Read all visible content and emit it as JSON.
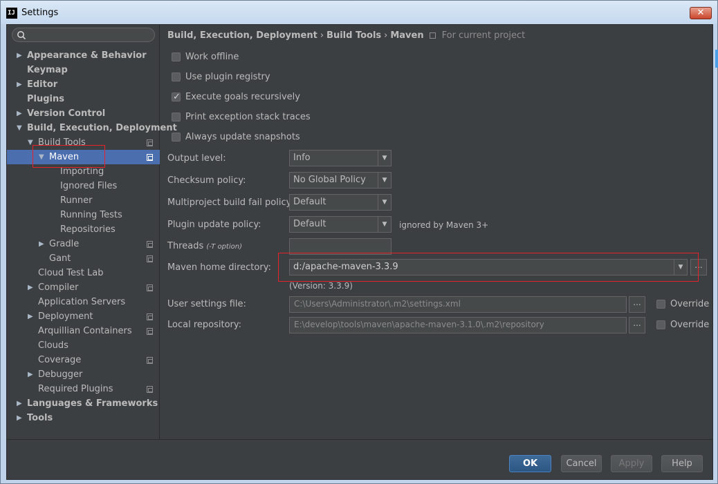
{
  "window": {
    "title": "Settings",
    "app_icon": "IJ",
    "close_label": "✕"
  },
  "search": {
    "placeholder": ""
  },
  "tree": [
    {
      "label": "Appearance & Behavior",
      "bold": true,
      "arrow": "▶",
      "level": 0
    },
    {
      "label": "Keymap",
      "bold": true,
      "arrow": "",
      "level": 0
    },
    {
      "label": "Editor",
      "bold": true,
      "arrow": "▶",
      "level": 0
    },
    {
      "label": "Plugins",
      "bold": true,
      "arrow": "",
      "level": 0
    },
    {
      "label": "Version Control",
      "bold": true,
      "arrow": "▶",
      "level": 0
    },
    {
      "label": "Build, Execution, Deployment",
      "bold": true,
      "arrow": "▼",
      "level": 0
    },
    {
      "label": "Build Tools",
      "bold": false,
      "arrow": "▼",
      "level": 1,
      "project": true
    },
    {
      "label": "Maven",
      "bold": false,
      "arrow": "▼",
      "level": 2,
      "project": true,
      "selected": true
    },
    {
      "label": "Importing",
      "bold": false,
      "arrow": "",
      "level": 3
    },
    {
      "label": "Ignored Files",
      "bold": false,
      "arrow": "",
      "level": 3
    },
    {
      "label": "Runner",
      "bold": false,
      "arrow": "",
      "level": 3
    },
    {
      "label": "Running Tests",
      "bold": false,
      "arrow": "",
      "level": 3
    },
    {
      "label": "Repositories",
      "bold": false,
      "arrow": "",
      "level": 3
    },
    {
      "label": "Gradle",
      "bold": false,
      "arrow": "▶",
      "level": 2,
      "project": true
    },
    {
      "label": "Gant",
      "bold": false,
      "arrow": "",
      "level": 2,
      "project": true
    },
    {
      "label": "Cloud Test Lab",
      "bold": false,
      "arrow": "",
      "level": 1
    },
    {
      "label": "Compiler",
      "bold": false,
      "arrow": "▶",
      "level": 1,
      "project": true
    },
    {
      "label": "Application Servers",
      "bold": false,
      "arrow": "",
      "level": 1
    },
    {
      "label": "Deployment",
      "bold": false,
      "arrow": "▶",
      "level": 1,
      "project": true
    },
    {
      "label": "Arquillian Containers",
      "bold": false,
      "arrow": "",
      "level": 1,
      "project": true
    },
    {
      "label": "Clouds",
      "bold": false,
      "arrow": "",
      "level": 1
    },
    {
      "label": "Coverage",
      "bold": false,
      "arrow": "",
      "level": 1,
      "project": true
    },
    {
      "label": "Debugger",
      "bold": false,
      "arrow": "▶",
      "level": 1
    },
    {
      "label": "Required Plugins",
      "bold": false,
      "arrow": "",
      "level": 1,
      "project": true
    },
    {
      "label": "Languages & Frameworks",
      "bold": true,
      "arrow": "▶",
      "level": 0
    },
    {
      "label": "Tools",
      "bold": true,
      "arrow": "▶",
      "level": 0
    }
  ],
  "breadcrumb": {
    "part1": "Build, Execution, Deployment",
    "part2": "Build Tools",
    "part3": "Maven",
    "separator": "›",
    "scope": "For current project"
  },
  "checkboxes": [
    {
      "label": "Work offline",
      "checked": false
    },
    {
      "label": "Use plugin registry",
      "checked": false
    },
    {
      "label": "Execute goals recursively",
      "checked": true
    },
    {
      "label": "Print exception stack traces",
      "checked": false
    },
    {
      "label": "Always update snapshots",
      "checked": false
    }
  ],
  "form": {
    "output_level": {
      "label": "Output level:",
      "value": "Info"
    },
    "checksum_policy": {
      "label": "Checksum policy:",
      "value": "No Global Policy"
    },
    "multiproject_policy": {
      "label": "Multiproject build fail policy:",
      "value": "Default"
    },
    "plugin_update_policy": {
      "label": "Plugin update policy:",
      "value": "Default",
      "note": "ignored by Maven 3+"
    },
    "threads": {
      "label": "Threads",
      "hint": "(-T option)",
      "value": ""
    },
    "maven_home": {
      "label": "Maven home directory:",
      "value": "d:/apache-maven-3.3.9",
      "version": "(Version: 3.3.9)"
    },
    "user_settings": {
      "label": "User settings file:",
      "value": "C:\\Users\\Administrator\\.m2\\settings.xml",
      "override": "Override"
    },
    "local_repo": {
      "label": "Local repository:",
      "value": "E:\\develop\\tools\\maven\\apache-maven-3.1.0\\.m2\\repository",
      "override": "Override"
    },
    "ellipsis": "...",
    "dropdown_arrow": "▼"
  },
  "buttons": {
    "ok": "OK",
    "cancel": "Cancel",
    "apply": "Apply",
    "help": "Help"
  }
}
